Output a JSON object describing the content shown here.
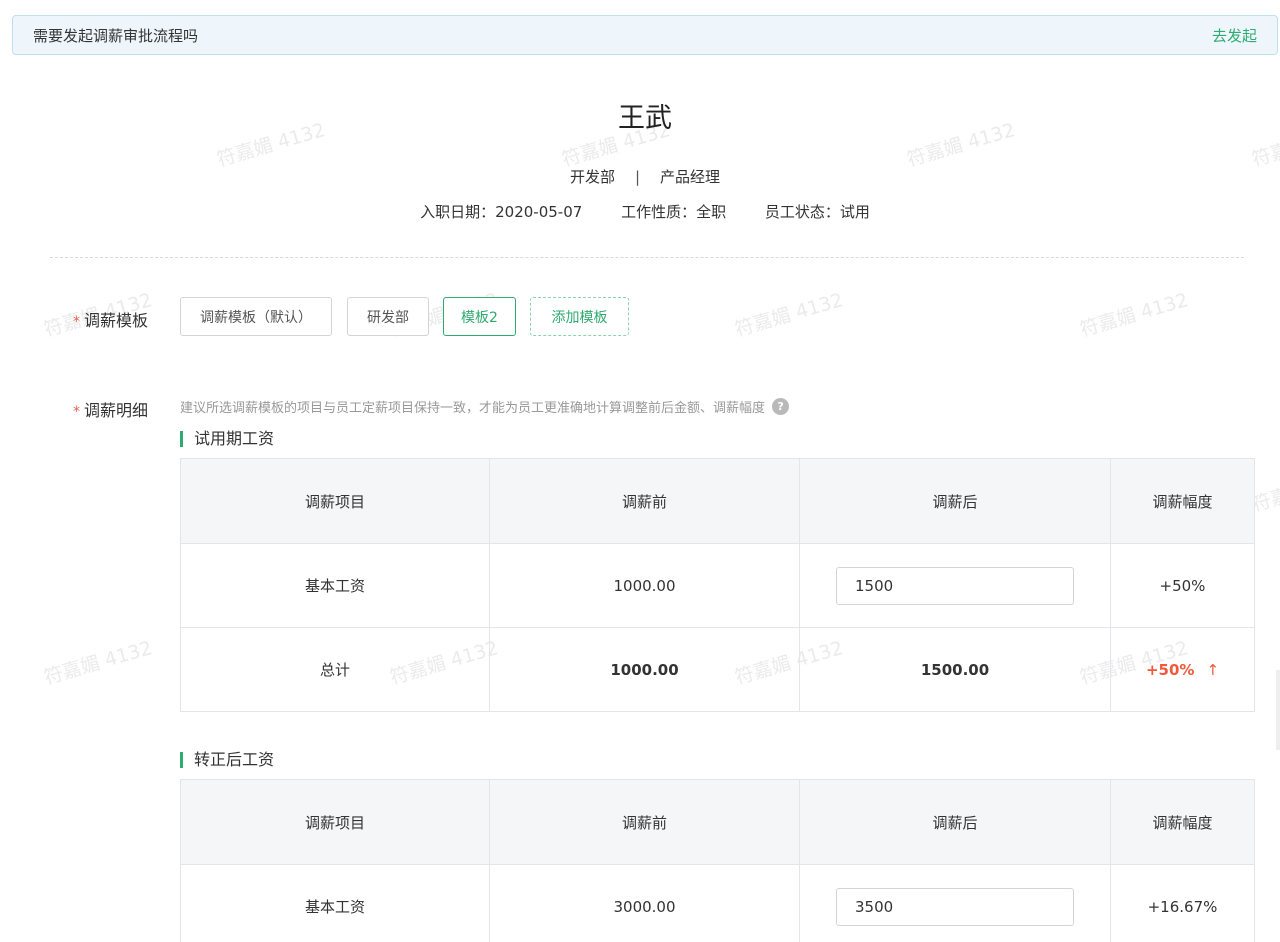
{
  "banner": {
    "message": "需要发起调薪审批流程吗",
    "action": "去发起"
  },
  "employee": {
    "name": "王武",
    "department": "开发部",
    "separator": "|",
    "position": "产品经理",
    "hire_date": "入职日期：2020-05-07",
    "work_type": "工作性质：全职",
    "status": "员工状态：试用"
  },
  "watermark_text": "符嘉媚 4132",
  "template_field": {
    "required_mark": "*",
    "label": "调薪模板",
    "options": [
      "调薪模板（默认）",
      "研发部",
      "模板2"
    ],
    "selected": "模板2",
    "add_label": "添加模板"
  },
  "detail_field": {
    "required_mark": "*",
    "label": "调薪明细",
    "hint": "建议所选调薪模板的项目与员工定薪项目保持一致，才能为员工更准确地计算调整前后金额、调薪幅度",
    "help_icon": "?"
  },
  "columns": [
    "调薪项目",
    "调薪前",
    "调薪后",
    "调薪幅度"
  ],
  "probation": {
    "title": "试用期工资",
    "rows": [
      {
        "item": "基本工资",
        "before": "1000.00",
        "after": "1500",
        "change": "+50%"
      }
    ],
    "total": {
      "item": "总计",
      "before": "1000.00",
      "after": "1500.00",
      "change": "+50%",
      "arrow": "↑"
    }
  },
  "regular": {
    "title": "转正后工资",
    "rows": [
      {
        "item": "基本工资",
        "before": "3000.00",
        "after": "3500",
        "change": "+16.67%"
      }
    ]
  },
  "colors": {
    "accent": "#2eab6e",
    "increase": "#f05a3c",
    "banner_bg": "#eef6fc"
  }
}
